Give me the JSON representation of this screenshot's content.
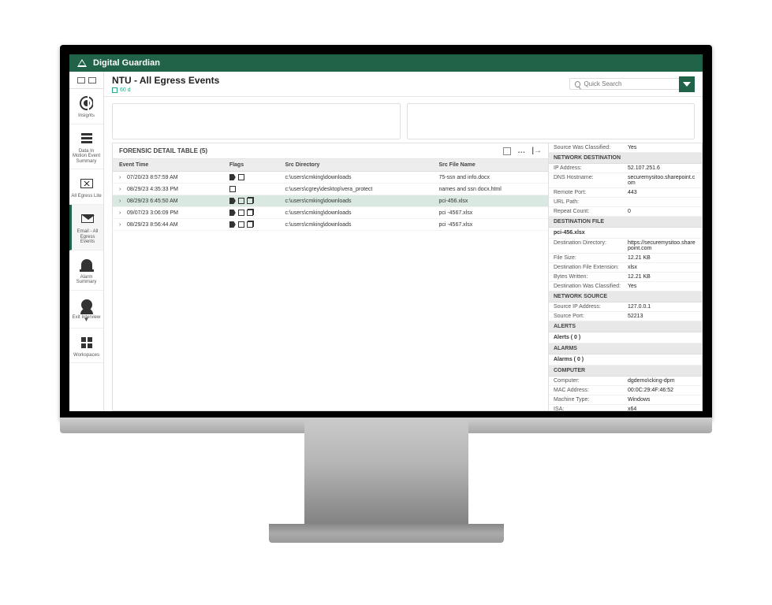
{
  "app": {
    "name": "Digital Guardian"
  },
  "page": {
    "title": "NTU - All Egress Events",
    "range": "60 d"
  },
  "search": {
    "placeholder": "Quick Search"
  },
  "sidebar": {
    "items": [
      {
        "label": "Insights"
      },
      {
        "label": "Data In Motion Event Summary"
      },
      {
        "label": "All Egress Lite"
      },
      {
        "label": "Email - All Egress Events"
      },
      {
        "label": "Alarm Summary"
      },
      {
        "label": "Exit Interview"
      },
      {
        "label": "Workspaces"
      }
    ]
  },
  "table": {
    "title": "FORENSIC DETAIL TABLE (5)",
    "columns": [
      "Event Time",
      "Flags",
      "Src Directory",
      "Src File Name"
    ],
    "rows": [
      {
        "time": "07/20/23 8:57:59 AM",
        "flags": [
          "tag",
          "doc"
        ],
        "dir": "c:\\users\\cmking\\downloads",
        "file": "75-ssn and info.docx",
        "selected": false
      },
      {
        "time": "08/29/23 4:35:33 PM",
        "flags": [
          "doc"
        ],
        "dir": "c:\\users\\cgrey\\desktop\\vera_protect",
        "file": "names and ssn docx.html",
        "selected": false
      },
      {
        "time": "08/29/23 6:45:50 AM",
        "flags": [
          "tag",
          "doc",
          "copy"
        ],
        "dir": "c:\\users\\cmking\\downloads",
        "file": "pci-456.xlsx",
        "selected": true
      },
      {
        "time": "09/07/23 3:06:09 PM",
        "flags": [
          "tag",
          "doc",
          "copy"
        ],
        "dir": "c:\\users\\cmking\\downloads",
        "file": "pci -4567.xlsx",
        "selected": false
      },
      {
        "time": "08/29/23 8:56:44 AM",
        "flags": [
          "tag",
          "doc",
          "copy"
        ],
        "dir": "c:\\users\\cmking\\downloads",
        "file": "pci -4567.xlsx",
        "selected": false
      }
    ]
  },
  "details": {
    "source_was_classified": {
      "k": "Source Was Classified:",
      "v": "Yes"
    },
    "sections": {
      "net_dest": "NETWORK DESTINATION",
      "dest_file": "DESTINATION FILE",
      "net_src": "NETWORK SOURCE",
      "alerts": "ALERTS",
      "alarms": "ALARMS",
      "computer": "COMPUTER"
    },
    "net_dest": [
      {
        "k": "IP Address:",
        "v": "52.107.251.6"
      },
      {
        "k": "DNS Hostname:",
        "v": "securemysitoo.sharepoint.com"
      },
      {
        "k": "Remote Port:",
        "v": "443"
      },
      {
        "k": "URL Path:",
        "v": ""
      },
      {
        "k": "Repeat Count:",
        "v": "0"
      }
    ],
    "dest_file_name": "pci-456.xlsx",
    "dest_file": [
      {
        "k": "Destination Directory:",
        "v": "https://securemysitoo.sharepoint.com"
      },
      {
        "k": "File Size:",
        "v": "12.21 KB"
      },
      {
        "k": "Destination File Extension:",
        "v": "xlsx"
      },
      {
        "k": "Bytes Written:",
        "v": "12.21 KB"
      },
      {
        "k": "Destination Was Classified:",
        "v": "Yes"
      }
    ],
    "net_src": [
      {
        "k": "Source IP Address:",
        "v": "127.0.0.1"
      },
      {
        "k": "Source Port:",
        "v": "52213"
      }
    ],
    "alerts_text": "Alerts ( 0 )",
    "alarms_text": "Alarms ( 0 )",
    "computer": [
      {
        "k": "Computer:",
        "v": "dgdemo\\cking-dpm"
      },
      {
        "k": "MAC Address:",
        "v": "00:0C:29:4F:46:52"
      },
      {
        "k": "Machine Type:",
        "v": "Windows"
      },
      {
        "k": "ISA:",
        "v": "x64"
      }
    ]
  }
}
